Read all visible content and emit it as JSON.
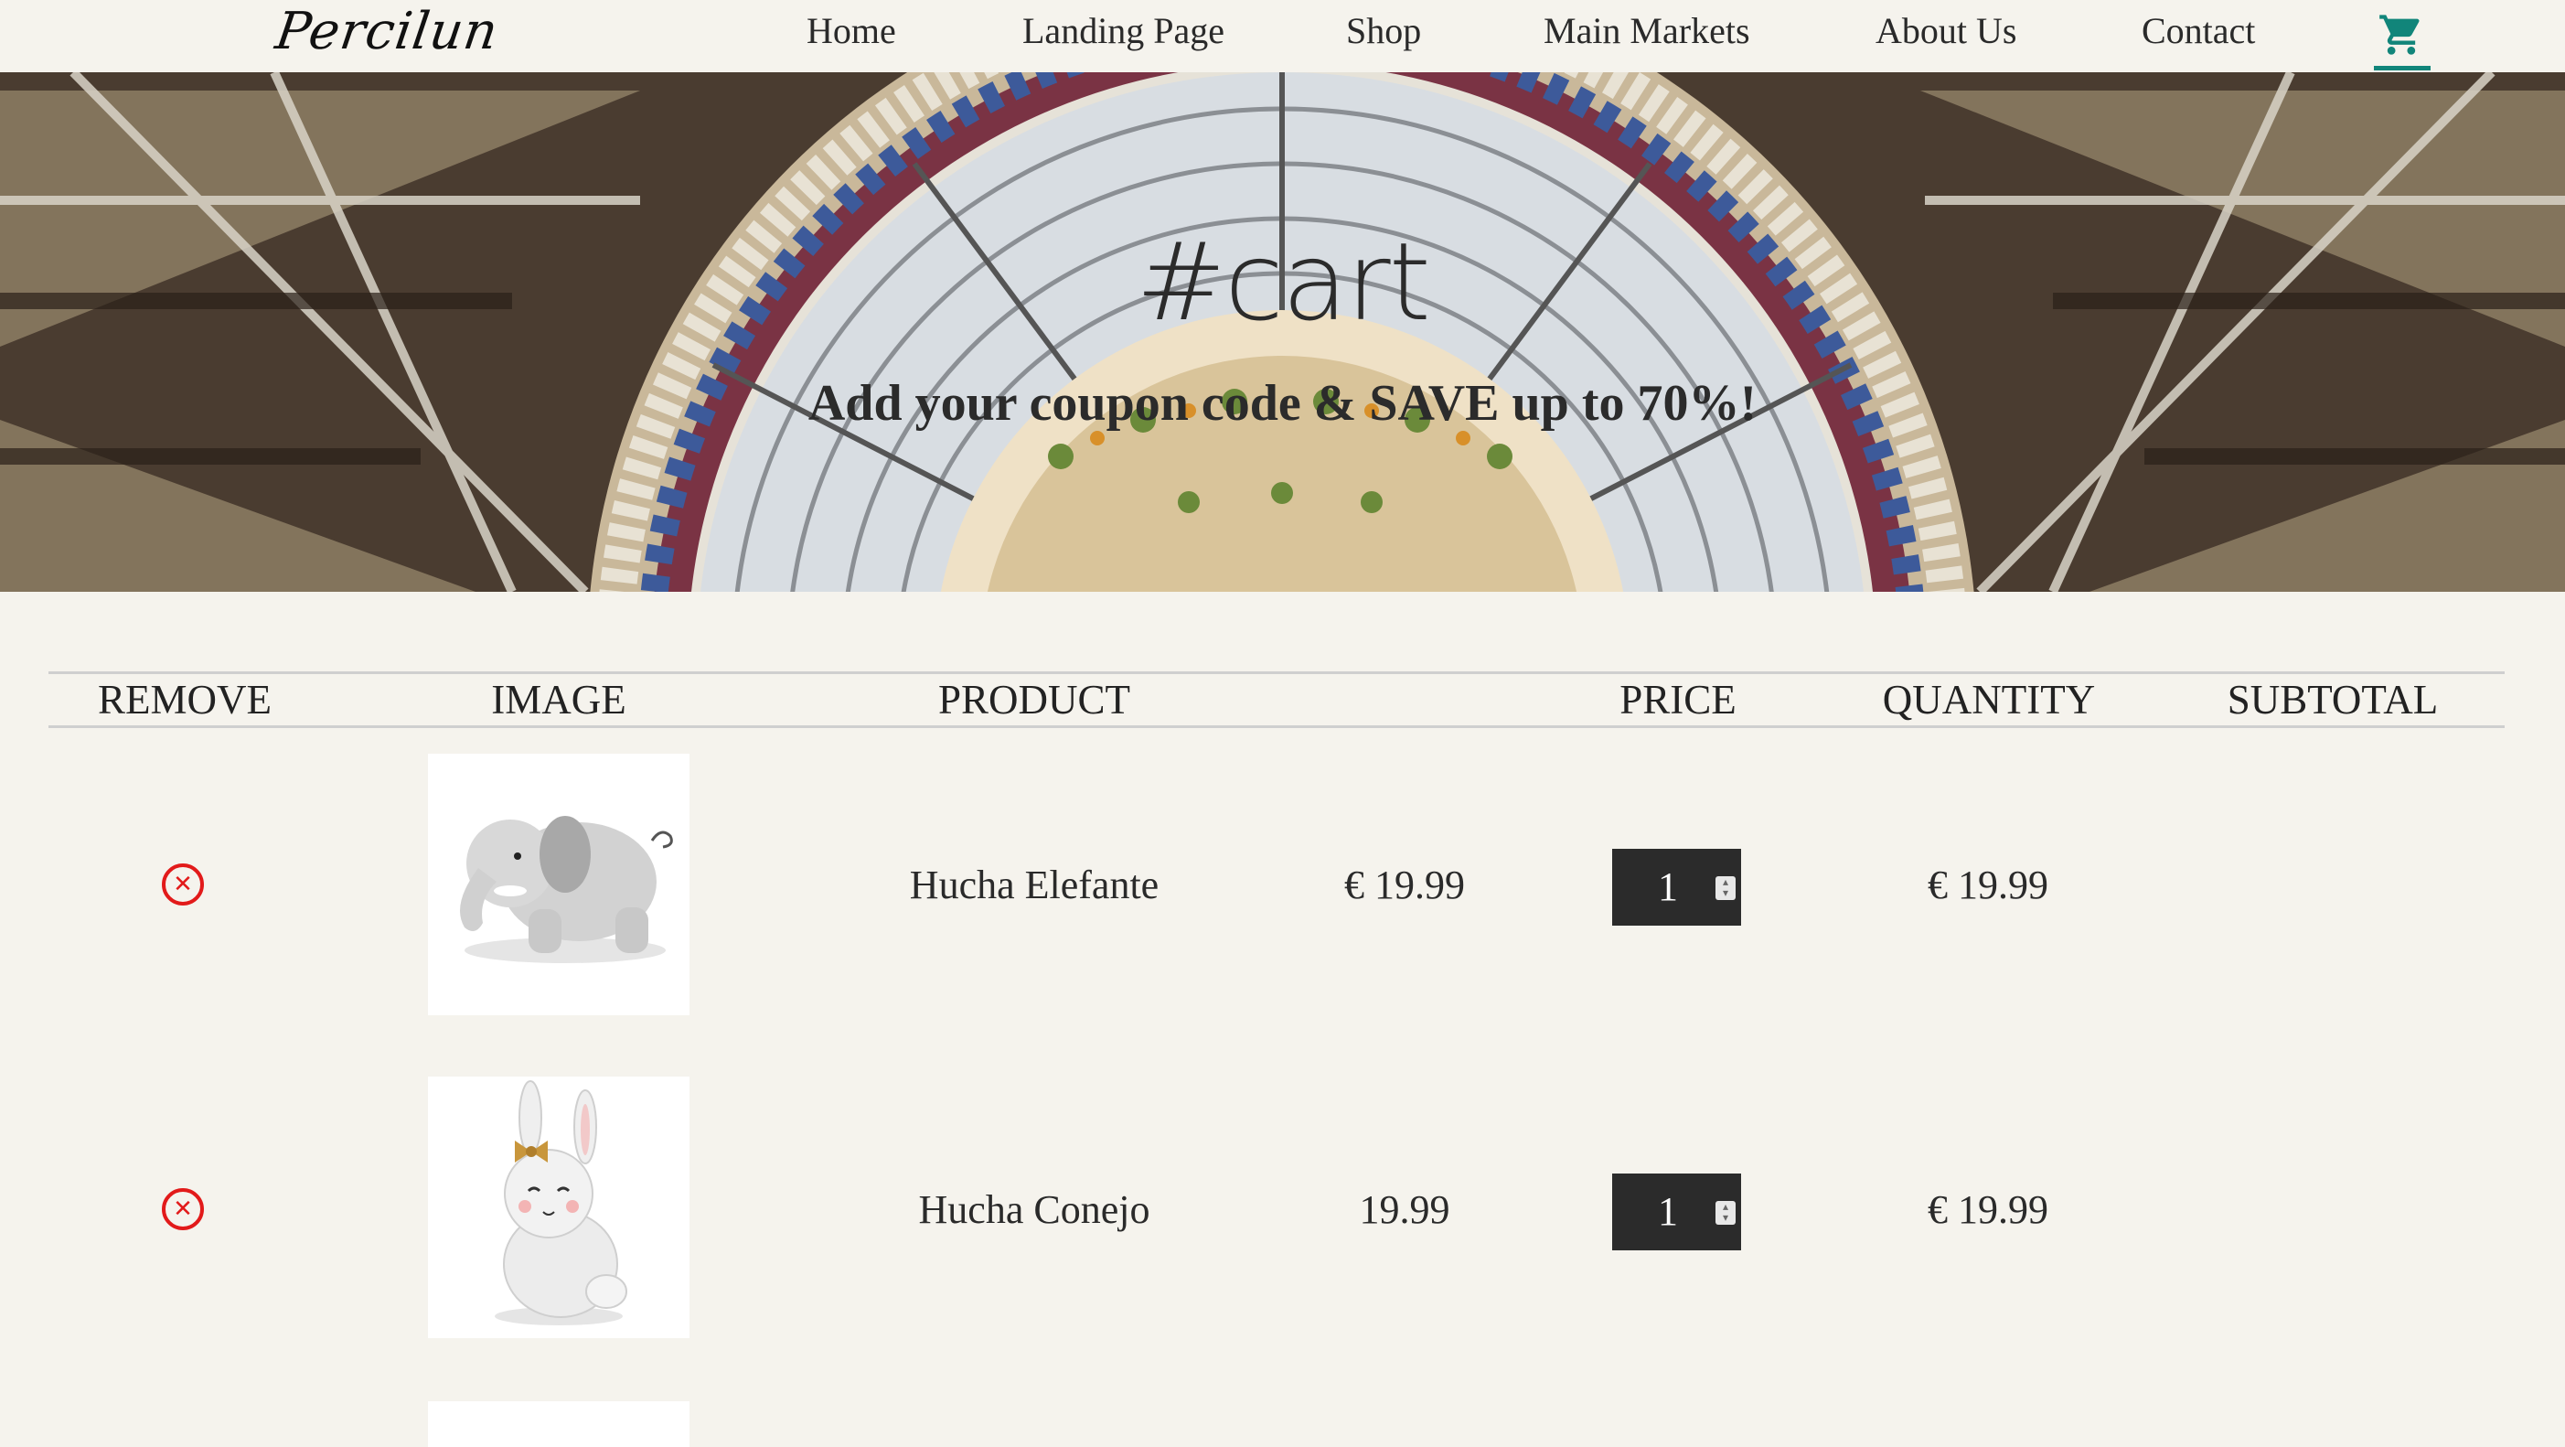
{
  "brand": {
    "logo": "Percilun"
  },
  "nav": {
    "items": [
      "Home",
      "Landing Page",
      "Shop",
      "Main Markets",
      "About Us",
      "Contact"
    ],
    "cart_icon": "shopping-cart-icon",
    "accent_color": "#11857a"
  },
  "hero": {
    "title": "#cart",
    "subtitle": "Add your coupon code & SAVE up to 70%!"
  },
  "table": {
    "headers": {
      "remove": "REMOVE",
      "image": "IMAGE",
      "product": "PRODUCT",
      "price": "PRICE",
      "quantity": "QUANTITY",
      "subtotal": "SUBTOTAL"
    },
    "rows": [
      {
        "product": "Hucha Elefante",
        "price": "€ 19.99",
        "quantity": "1",
        "subtotal": "€ 19.99",
        "image_icon": "elephant-figurine"
      },
      {
        "product": "Hucha Conejo",
        "price": "19.99",
        "quantity": "1",
        "subtotal": "€ 19.99",
        "image_icon": "bunny-figurine"
      }
    ]
  },
  "colors": {
    "remove": "#e21a1a",
    "background": "#f5f3ed"
  }
}
